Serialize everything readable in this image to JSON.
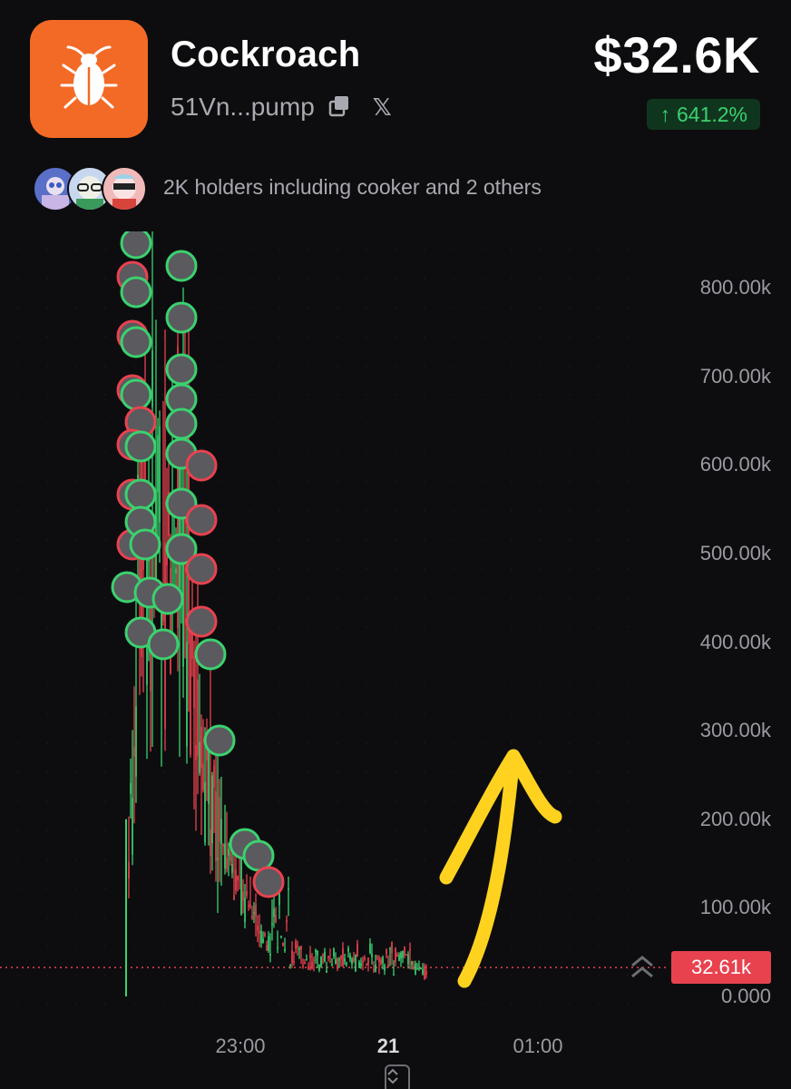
{
  "token": {
    "name": "Cockroach",
    "address": "51Vn...pump",
    "icon": "cockroach-icon",
    "logo_color": "#f26a26"
  },
  "header": {
    "price": "$32.6K",
    "change": "641.2%",
    "change_arrow": "↑",
    "change_color": "#3bd16f",
    "copy_icon": "copy-icon",
    "x_icon": "x-icon",
    "x_label": "𝕏"
  },
  "holders": {
    "text": "2K holders including cooker and 2 others",
    "avatars": [
      "holder-avatar-1",
      "holder-avatar-2",
      "holder-avatar-3"
    ]
  },
  "chart_data": {
    "type": "candlestick",
    "y_ticks": [
      "800.00k",
      "700.00k",
      "600.00k",
      "500.00k",
      "400.00k",
      "300.00k",
      "200.00k",
      "100.00k",
      "0.000"
    ],
    "y_tick_values": [
      800000,
      700000,
      600000,
      500000,
      400000,
      300000,
      200000,
      100000,
      0
    ],
    "x_ticks": [
      "23:00",
      "21",
      "01:00"
    ],
    "current_value": 32610,
    "current_label": "32.61k",
    "up_color": "#3bd16f",
    "down_color": "#e8424f",
    "annotation": "yellow-arrow-up"
  }
}
